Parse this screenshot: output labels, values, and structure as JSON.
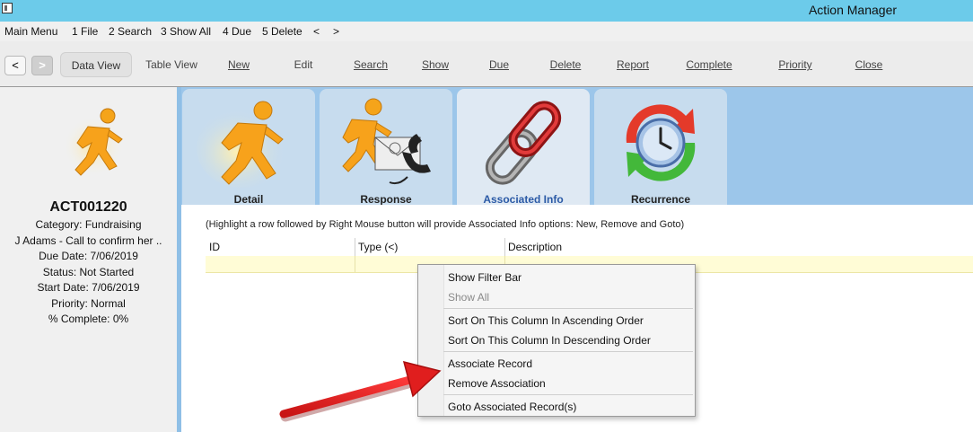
{
  "window": {
    "title": "Action Manager"
  },
  "main_menu": [
    "Main Menu",
    "1 File",
    "2 Search",
    "3 Show All",
    "4 Due",
    "5 Delete",
    "<",
    ">"
  ],
  "toolbar": {
    "back_label": "<",
    "forward_label": ">",
    "items": [
      "Data View",
      "Table View",
      "New",
      "Edit",
      "Search",
      "Show",
      "Due",
      "Delete",
      "Report",
      "Complete",
      "Priority",
      "Close"
    ],
    "active": "Data View"
  },
  "record": {
    "id": "ACT001220",
    "category": "Category: Fundraising",
    "subject": "J Adams - Call to confirm her ..",
    "due_date": "Due Date: 7/06/2019",
    "status": "Status: Not Started",
    "start_date": "Start Date: 7/06/2019",
    "priority": "Priority: Normal",
    "complete": "% Complete: 0%"
  },
  "tabs": [
    {
      "label": "Detail",
      "icon": "running-man-icon"
    },
    {
      "label": "Response",
      "icon": "running-man-phone-icon"
    },
    {
      "label": "Associated Info",
      "icon": "chain-link-icon",
      "active": true
    },
    {
      "label": "Recurrence",
      "icon": "clock-cycle-icon"
    }
  ],
  "hint": "(Highlight a row followed by Right Mouse button will provide Associated Info options: New, Remove and Goto)",
  "grid": {
    "columns": [
      "ID",
      "Type (<)",
      "Description"
    ]
  },
  "context_menu": {
    "items": [
      {
        "label": "Show Filter Bar",
        "enabled": true
      },
      {
        "label": "Show All",
        "enabled": false
      },
      {
        "label": "Sort On This Column In Ascending Order",
        "enabled": true
      },
      {
        "label": "Sort On This Column In Descending Order",
        "enabled": true
      },
      {
        "label": "Associate Record",
        "enabled": true
      },
      {
        "label": "Remove Association",
        "enabled": true
      },
      {
        "label": "Goto Associated Record(s)",
        "enabled": true
      }
    ]
  },
  "colors": {
    "title_bar": "#6ccbea",
    "tab_strip": "#9cc6ea",
    "highlight_row": "#fffcd6",
    "arrow": "#e01e1e"
  }
}
